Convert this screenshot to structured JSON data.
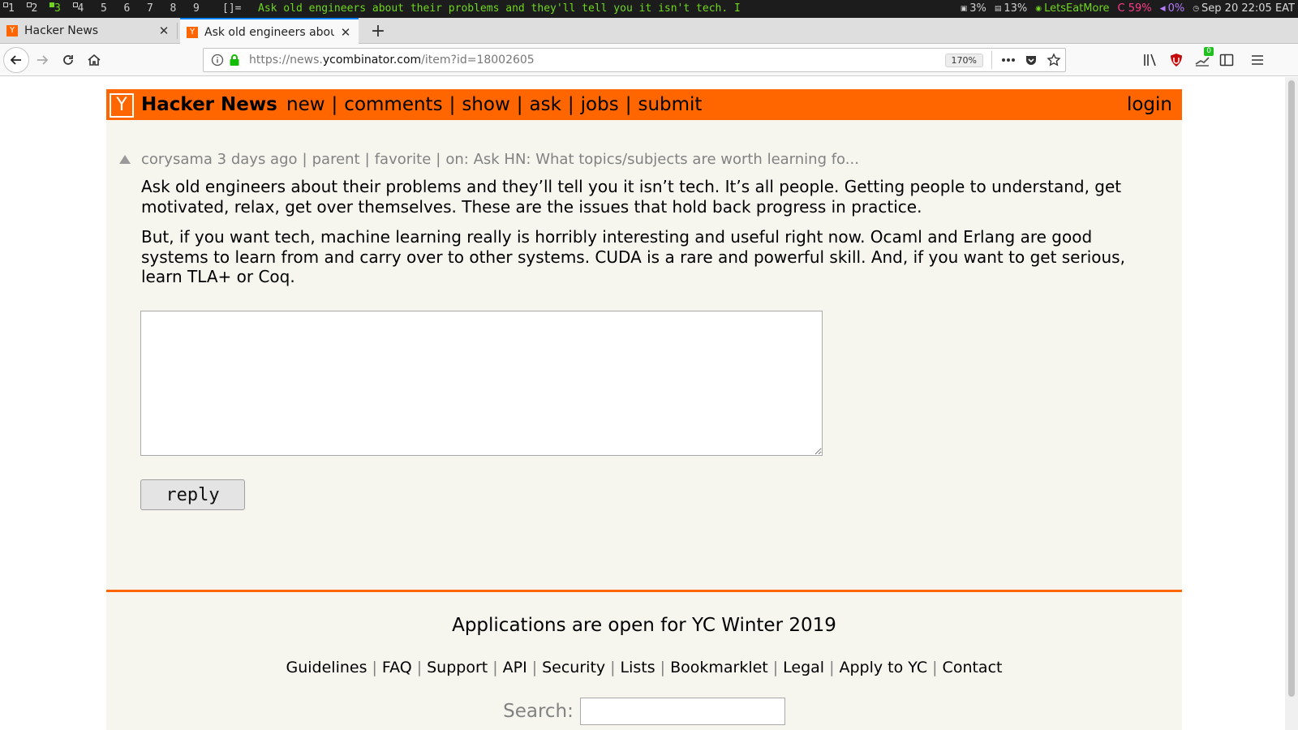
{
  "wm": {
    "workspaces": [
      "1",
      "2",
      "3",
      "4",
      "5",
      "6",
      "7",
      "8",
      "9"
    ],
    "active_workspace": "3",
    "layout": "[]=",
    "window_title": "Ask old engineers about their problems and they'll tell you it isn't tech. I",
    "status": {
      "cpu": "3%",
      "mem": "13%",
      "wifi": "LetsEatMore",
      "battery": "C 59%",
      "volume": "0%",
      "datetime": "Sep 20 22:05 EAT"
    },
    "colors": {
      "accent": "#6fd61c",
      "battery": "#ff3c8c",
      "volume": "#b57cff"
    }
  },
  "browser": {
    "tabs": [
      {
        "title": "Hacker News",
        "favicon": "Y"
      },
      {
        "title": "Ask old engineers about t",
        "favicon": "Y"
      }
    ],
    "new_tab_label": "+",
    "url_scheme": "https://news.",
    "url_host": "ycombinator.com",
    "url_path": "/item?id=18002605",
    "zoom": "170%",
    "extension_badge": "0"
  },
  "hn": {
    "logo": "Y",
    "site_name": "Hacker News",
    "nav": [
      "new",
      "comments",
      "show",
      "ask",
      "jobs",
      "submit"
    ],
    "login": "login",
    "comhead": {
      "user": "corysama",
      "age": "3 days ago",
      "parent": "parent",
      "favorite": "favorite",
      "on_prefix": "on:",
      "story": "Ask HN: What topics/subjects are worth learning fo..."
    },
    "comment_paragraphs": [
      "Ask old engineers about their problems and they’ll tell you it isn’t tech. It’s all people. Getting people to understand, get motivated, relax, get over themselves. These are the issues that hold back progress in practice.",
      "But, if you want tech, machine learning really is horribly interesting and useful right now. Ocaml and Erlang are good systems to learn from and carry over to other systems. CUDA is a rare and powerful skill. And, if you want to get serious, learn TLA+ or Coq."
    ],
    "reply_value": "",
    "reply_button": "reply",
    "footer_banner": "Applications are open for YC Winter 2019",
    "footer_links": [
      "Guidelines",
      "FAQ",
      "Support",
      "API",
      "Security",
      "Lists",
      "Bookmarklet",
      "Legal",
      "Apply to YC",
      "Contact"
    ],
    "search_label": "Search:",
    "search_value": "",
    "colors": {
      "orange": "#ff6600",
      "background": "#f6f6ef",
      "meta": "#828282"
    }
  }
}
